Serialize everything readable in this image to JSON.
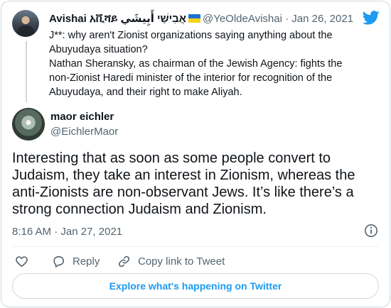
{
  "parent_tweet": {
    "name": "Avishai አቪሻይ אֲבִישַׁי أَبِيشَي",
    "handle": "@YeOldeAvishai",
    "separator": "·",
    "date": "Jan 26, 2021",
    "text_lines": [
      "J**: why aren't Zionist organizations saying anything about the Abuyudaya situation?",
      "Nathan Sheransky, as chairman of the Jewish Agency: fights the non-Zionist Haredi minister of the interior for recognition of the Abuyudaya, and their right to make Aliyah."
    ]
  },
  "tweet": {
    "name": "maor eichler",
    "handle": "@EichlerMaor",
    "text": "Interesting that as soon as some people convert to Judaism, they take an interest in Zionism, whereas the anti-Zionists are non-observant Jews. It’s like there’s a strong connection Judaism and Zionism.",
    "time": "8:16 AM",
    "separator": "·",
    "date": "Jan 27, 2021"
  },
  "actions": {
    "reply_label": "Reply",
    "copy_link_label": "Copy link to Tweet"
  },
  "explore_label": "Explore what's happening on Twitter",
  "icons": {
    "brand": "twitter-bird-icon",
    "info": "info-icon",
    "like": "heart-icon",
    "reply": "reply-icon",
    "copy": "link-icon"
  },
  "colors": {
    "accent": "#1d9bf0",
    "text": "#0f1419",
    "secondary": "#536471",
    "border": "#cfd9de"
  }
}
